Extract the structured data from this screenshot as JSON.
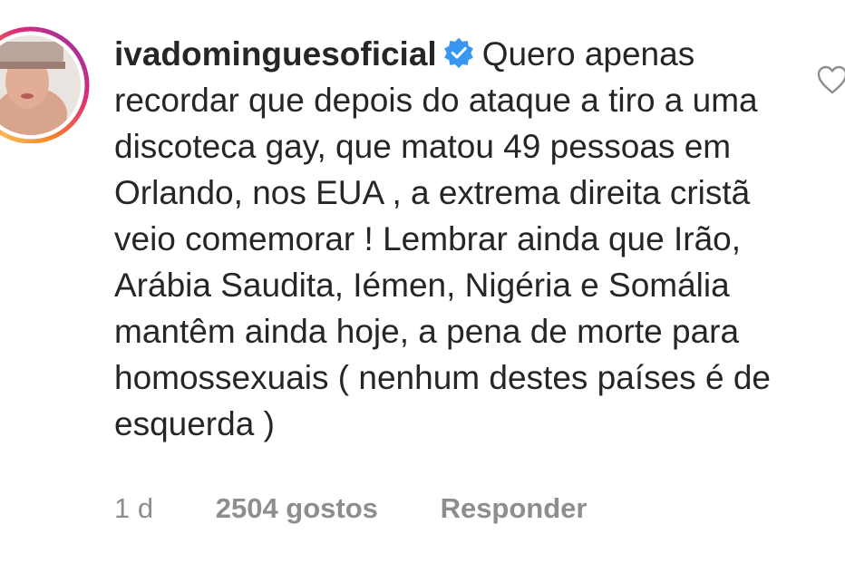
{
  "comment": {
    "username": "ivadominguesoficial",
    "verified_icon": "verified-badge-icon",
    "text": "Quero apenas recordar que depois do ataque a tiro a uma discoteca gay, que matou 49 pessoas em Orlando, nos EUA , a extrema direita cristã veio comemorar ! Lembrar ainda que Irão, Arábia Saudita, Iémen, Nigéria e Somália mantêm ainda hoje, a pena de morte para homossexuais ( nenhum destes países é de esquerda )"
  },
  "meta": {
    "time": "1 d",
    "likes": "2504 gostos",
    "reply_label": "Responder"
  },
  "icons": {
    "avatar": "profile-avatar",
    "like": "heart-outline-icon"
  },
  "colors": {
    "verified_blue": "#3897f0",
    "muted_text": "#8e8e8e",
    "story_ring_start": "#f58529",
    "story_ring_end": "#c13584"
  }
}
